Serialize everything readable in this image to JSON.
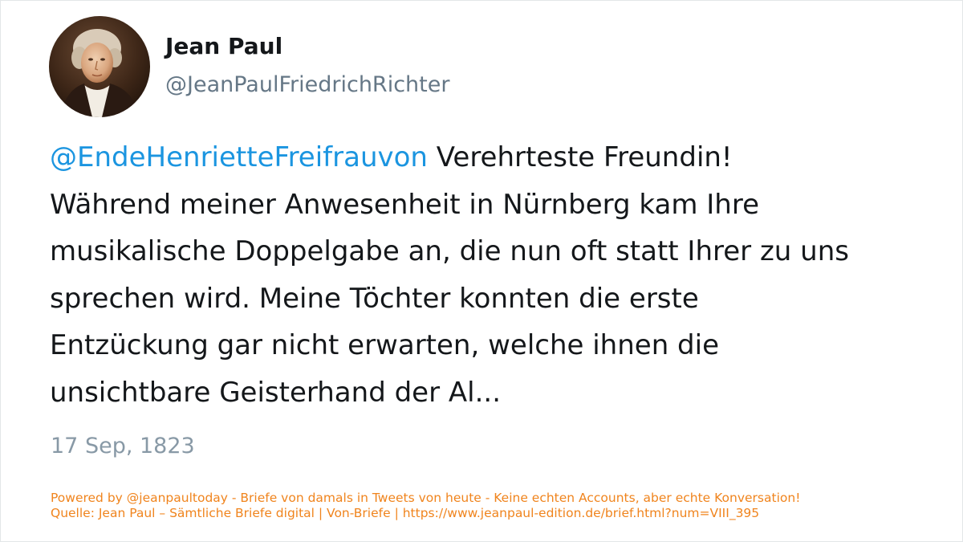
{
  "author": {
    "name": "Jean Paul",
    "handle": "@JeanPaulFriedrichRichter",
    "avatar_icon": "portrait-avatar-icon"
  },
  "tweet": {
    "mention": "@EndeHenrietteFreifrauvon",
    "lines": [
      " Verehrteste Freundin!",
      "Während meiner Anwesenheit in Nürnberg kam Ihre",
      "musikalische Doppelgabe an, die nun oft statt Ihrer zu uns",
      "sprechen wird. Meine Töchter konnten die erste",
      "Entzückung gar nicht erwarten, welche ihnen die",
      "unsichtbare Geisterhand der Al..."
    ],
    "date": "17 Sep, 1823"
  },
  "footer": {
    "line1": "Powered by @jeanpaultoday - Briefe von damals in Tweets von heute - Keine echten Accounts, aber echte Konversation!",
    "line2": "Quelle: Jean Paul – Sämtliche Briefe digital | Von-Briefe | https://www.jeanpaul-edition.de/brief.html?num=VIII_395"
  },
  "colors": {
    "mention": "#1b95e0",
    "text": "#14171a",
    "handle": "#657786",
    "date": "#8899a6",
    "footer": "#f0841d"
  }
}
